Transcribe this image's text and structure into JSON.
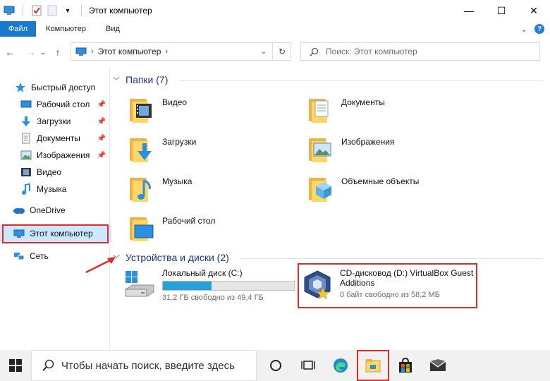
{
  "window": {
    "title": "Этот компьютер",
    "minimize": "—",
    "maximize": "☐",
    "close": "✕"
  },
  "ribbon": {
    "tabs": [
      "Файл",
      "Компьютер",
      "Вид"
    ],
    "expand": "⌄",
    "help": "?"
  },
  "address": {
    "back": "←",
    "forward": "→",
    "recent": "⌄",
    "up": "↑",
    "path": "Этот компьютер",
    "sep": "›",
    "dropdown": "⌄",
    "refresh": "↻",
    "search_placeholder": "Поиск: Этот компьютер"
  },
  "nav": {
    "items": [
      {
        "label": "Быстрый доступ",
        "icon": "star-icon"
      },
      {
        "label": "Рабочий стол",
        "icon": "desktop-icon",
        "pinned": true
      },
      {
        "label": "Загрузки",
        "icon": "download-icon",
        "pinned": true
      },
      {
        "label": "Документы",
        "icon": "document-icon",
        "pinned": true
      },
      {
        "label": "Изображения",
        "icon": "pictures-icon",
        "pinned": true
      },
      {
        "label": "Видео",
        "icon": "video-icon"
      },
      {
        "label": "Музыка",
        "icon": "music-icon"
      },
      {
        "label": "OneDrive",
        "icon": "cloud-icon"
      },
      {
        "label": "Этот компьютер",
        "icon": "computer-icon",
        "selected": true
      },
      {
        "label": "Сеть",
        "icon": "network-icon"
      }
    ]
  },
  "folders": {
    "header": "Папки (7)",
    "items": [
      {
        "label": "Видео",
        "icon": "video-folder-icon"
      },
      {
        "label": "Документы",
        "icon": "documents-folder-icon"
      },
      {
        "label": "Загрузки",
        "icon": "downloads-folder-icon"
      },
      {
        "label": "Изображения",
        "icon": "pictures-folder-icon"
      },
      {
        "label": "Музыка",
        "icon": "music-folder-icon"
      },
      {
        "label": "Объемные объекты",
        "icon": "3d-objects-folder-icon"
      },
      {
        "label": "Рабочий стол",
        "icon": "desktop-folder-icon"
      }
    ]
  },
  "drives": {
    "header": "Устройства и диски (2)",
    "items": [
      {
        "name": "Локальный диск (C:)",
        "free": "31,2 ГБ свободно из 49,4 ГБ",
        "used_fraction": 0.37,
        "icon": "local-disk-icon"
      },
      {
        "name_line1": "CD-дисковод (D:) VirtualBox Guest",
        "name_line2": "Additions",
        "free": "0 байт свободно из 58,2 МБ",
        "icon": "virtualbox-cd-icon"
      }
    ]
  },
  "taskbar": {
    "search_placeholder": "Чтобы начать поиск, введите здесь",
    "icons": [
      "windows-start-icon",
      "cortana-icon",
      "task-view-icon",
      "edge-icon",
      "file-explorer-icon",
      "store-icon",
      "mail-icon"
    ]
  },
  "colors": {
    "accent": "#1979ca",
    "highlight_red": "#e02b2b",
    "progress": "#26a0da",
    "section_header": "#1e3287"
  }
}
